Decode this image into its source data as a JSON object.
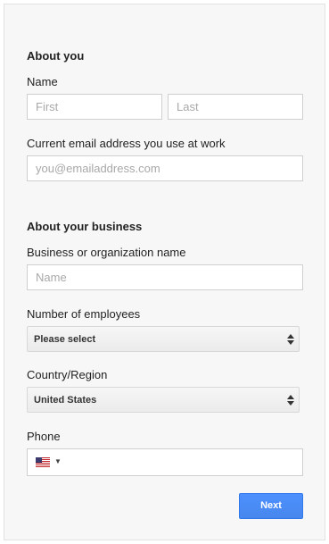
{
  "about_you": {
    "title": "About you",
    "name_label": "Name",
    "first_placeholder": "First",
    "last_placeholder": "Last",
    "email_label": "Current email address you use at work",
    "email_placeholder": "you@emailaddress.com"
  },
  "about_business": {
    "title": "About your business",
    "org_label": "Business or organization name",
    "org_placeholder": "Name",
    "employees_label": "Number of employees",
    "employees_value": "Please select",
    "country_label": "Country/Region",
    "country_value": "United States",
    "phone_label": "Phone",
    "phone_flag_icon": "us-flag-icon",
    "phone_value": ""
  },
  "actions": {
    "next_label": "Next"
  },
  "colors": {
    "primary_button": "#4d90fe",
    "card_background": "#f7f7f7"
  }
}
